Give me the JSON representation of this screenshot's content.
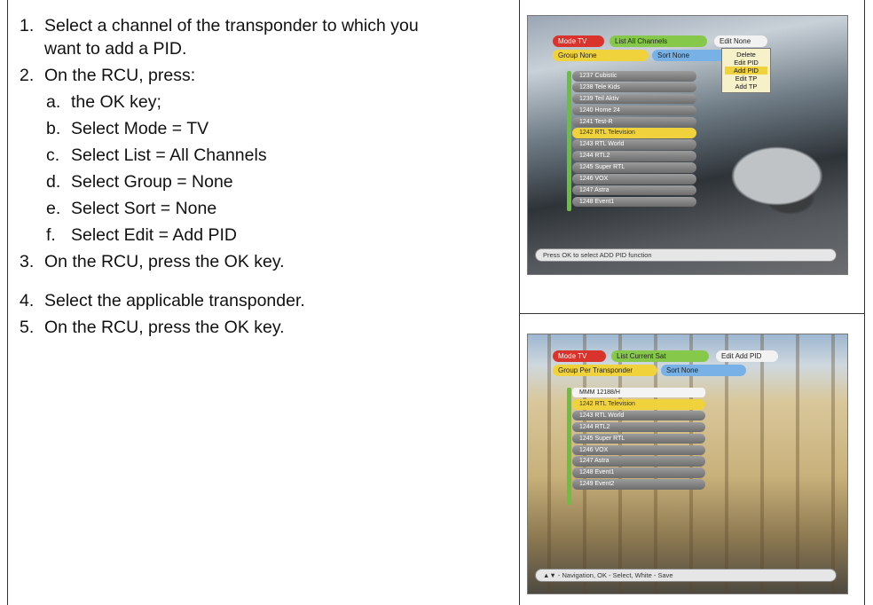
{
  "steps": [
    {
      "num": "1.",
      "text": "Select a channel of the transponder to which you",
      "cont": "want to add a PID."
    },
    {
      "num": "2.",
      "text": "On the RCU, press:"
    },
    {
      "num": "3.",
      "text": "On the RCU, press the OK key."
    },
    {
      "num": "4.",
      "text": "Select the applicable transponder."
    },
    {
      "num": "5.",
      "text": "On the RCU, press the OK key."
    }
  ],
  "substeps": [
    {
      "num": "a.",
      "text": "the OK key;"
    },
    {
      "num": "b.",
      "text": "Select Mode = TV"
    },
    {
      "num": "c.",
      "text": "Select List = All Channels"
    },
    {
      "num": "d.",
      "text": "Select Group = None"
    },
    {
      "num": "e.",
      "text": "Select Sort = None"
    },
    {
      "num": "f.",
      "text": "Select Edit = Add PID"
    }
  ],
  "screen1": {
    "mode_label": "Mode",
    "mode_value": "TV",
    "list_label": "List",
    "list_value": "All Channels",
    "edit_label": "Edit",
    "edit_value": "None",
    "group_label": "Group",
    "group_value": "None",
    "sort_label": "Sort",
    "sort_value": "None",
    "edit_menu": [
      "Delete",
      "Edit PID",
      "Add PID",
      "Edit TP",
      "Add TP"
    ],
    "channels": [
      "1237 Cubistic",
      "1238 Tele Kids",
      "1239 Teil Aktiv",
      "1240 Home 24",
      "1241 Test-R",
      "1242 RTL Television",
      "1243 RTL World",
      "1244 RTL2",
      "1245 Super RTL",
      "1246 VOX",
      "1247 Astra",
      "1248 Event1"
    ],
    "status": "Press OK to select ADD PID function"
  },
  "screen2": {
    "mode_label": "Mode",
    "mode_value": "TV",
    "list_label": "List",
    "list_value": "Current Sat",
    "edit_label": "Edit",
    "edit_value": "Add PID",
    "group_label": "Group",
    "group_value": "Per Transponder",
    "sort_label": "Sort",
    "sort_value": "None",
    "transponder": "MMM 12188/H",
    "channels": [
      "1242 RTL Television",
      "1243 RTL World",
      "1244 RTL2",
      "1245 Super RTL",
      "1246 VOX",
      "1247 Astra",
      "1248 Event1",
      "1249 Event2"
    ],
    "status": "▲▼ - Navigation, OK - Select, White - Save"
  }
}
